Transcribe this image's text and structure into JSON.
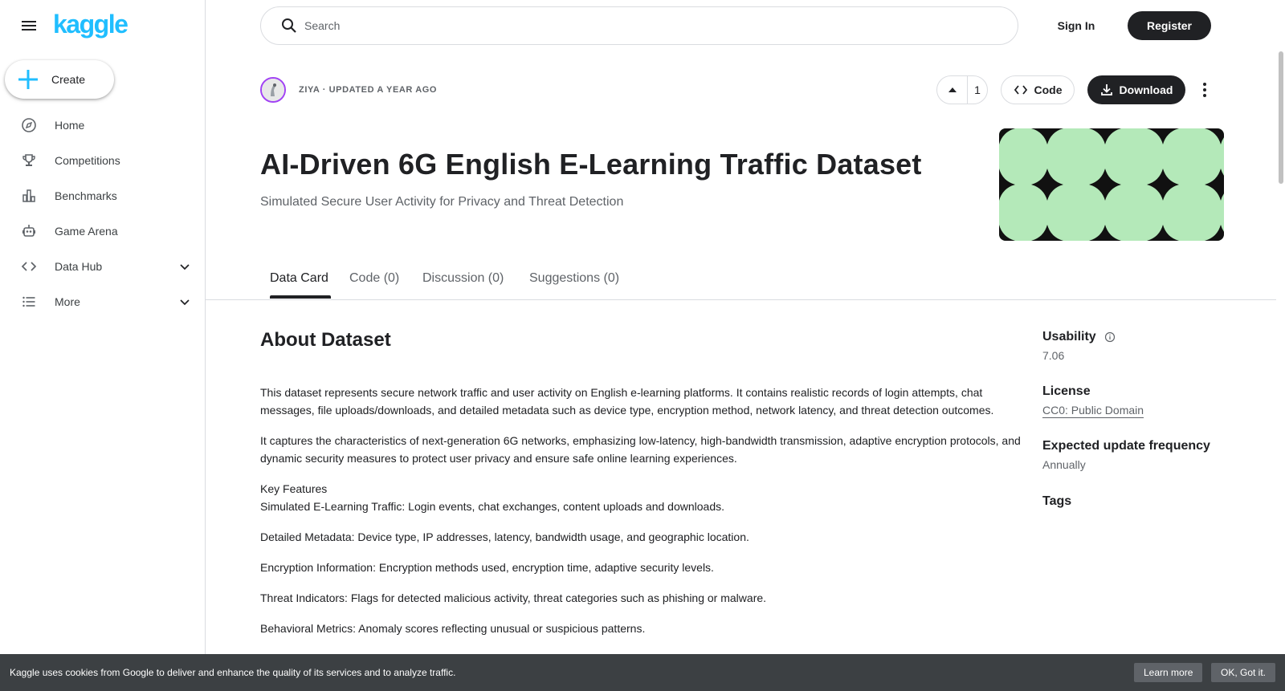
{
  "sidebar": {
    "logo": "kaggle",
    "create_label": "Create",
    "items": [
      {
        "label": "Home",
        "icon": "compass-icon"
      },
      {
        "label": "Competitions",
        "icon": "trophy-icon"
      },
      {
        "label": "Benchmarks",
        "icon": "bar-chart-icon"
      },
      {
        "label": "Game Arena",
        "icon": "robot-icon"
      },
      {
        "label": "Data Hub",
        "icon": "code-icon"
      },
      {
        "label": "More",
        "icon": "list-icon"
      }
    ]
  },
  "header": {
    "search_placeholder": "Search",
    "sign_in": "Sign In",
    "register": "Register"
  },
  "dataset": {
    "meta": "ZIYA · UPDATED A YEAR AGO",
    "upvotes": "1",
    "code_label": "Code",
    "download_label": "Download",
    "title": "AI-Driven 6G English E-Learning Traffic Dataset",
    "subtitle": "Simulated Secure User Activity for Privacy and Threat Detection",
    "banner_color": "#b4e9b9"
  },
  "tabs": [
    "Data Card",
    "Code (0)",
    "Discussion (0)",
    "Suggestions (0)"
  ],
  "about": {
    "heading": "About Dataset",
    "p1": "This dataset represents secure network traffic and user activity on English e-learning platforms. It contains realistic records of login attempts, chat messages, file uploads/downloads, and detailed metadata such as device type, encryption method, network latency, and threat detection outcomes.",
    "p2": "It captures the characteristics of next-generation 6G networks, emphasizing low-latency, high-bandwidth transmission, adaptive encryption protocols, and dynamic security measures to protect user privacy and ensure safe online learning experiences.",
    "p3_title": "Key Features",
    "p3": "Simulated E-Learning Traffic: Login events, chat exchanges, content uploads and downloads.",
    "p4": "Detailed Metadata: Device type, IP addresses, latency, bandwidth usage, and geographic location.",
    "p5": "Encryption Information: Encryption methods used, encryption time, adaptive security levels.",
    "p6": "Threat Indicators: Flags for detected malicious activity, threat categories such as phishing or malware.",
    "p7": "Behavioral Metrics: Anomaly scores reflecting unusual or suspicious patterns."
  },
  "side": {
    "usability_label": "Usability",
    "usability_value": "7.06",
    "license_label": "License",
    "license_value": "CC0: Public Domain",
    "freq_label": "Expected update frequency",
    "freq_value": "Annually",
    "tags_label": "Tags"
  },
  "cookie": {
    "message": "Kaggle uses cookies from Google to deliver and enhance the quality of its services and to analyze traffic.",
    "learn_more": "Learn more",
    "ok": "OK, Got it."
  }
}
